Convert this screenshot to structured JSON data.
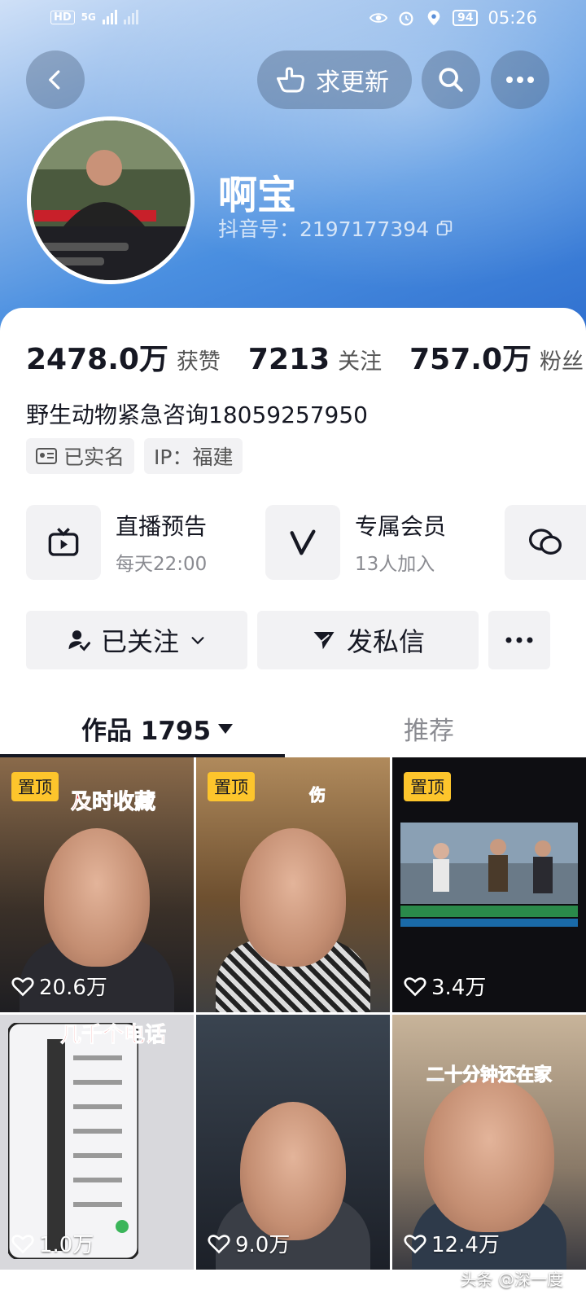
{
  "status_bar": {
    "hd": "HD",
    "net": "5G",
    "battery": "94",
    "time": "05:26"
  },
  "header": {
    "request_update_label": "求更新",
    "name": "啊宝",
    "douyin_id": "抖音号：2197177394"
  },
  "stats": [
    {
      "value": "2478.0万",
      "label": "获赞"
    },
    {
      "value": "7213",
      "label": "关注"
    },
    {
      "value": "757.0万",
      "label": "粉丝"
    }
  ],
  "bio": "野生动物紧急咨询18059257950",
  "tags": {
    "verified": "已实名",
    "ip": "IP：福建"
  },
  "features": [
    {
      "title": "直播预告",
      "subtitle": "每天22:00",
      "icon": "tv-icon"
    },
    {
      "title": "专属会员",
      "subtitle": "13人加入",
      "icon": "v-icon"
    }
  ],
  "actions": {
    "followed_label": "已关注",
    "message_label": "发私信"
  },
  "tabs": {
    "works_label": "作品 1795",
    "recommend_label": "推荐"
  },
  "videos": [
    {
      "pinned": "置顶",
      "caption": "及时收藏",
      "likes": "20.6万"
    },
    {
      "pinned": "置顶",
      "caption": "伤",
      "likes": ""
    },
    {
      "pinned": "置顶",
      "caption": "",
      "likes": "3.4万"
    },
    {
      "pinned": "",
      "caption": "几千个电话",
      "likes": "1.0万"
    },
    {
      "pinned": "",
      "caption": "",
      "likes": "9.0万"
    },
    {
      "pinned": "",
      "caption": "二十分钟还在家",
      "likes": "12.4万"
    }
  ],
  "watermark": "头条 @深一度",
  "colors": {
    "pin_yellow": "#fdc52c",
    "caption_red": "#e02020",
    "header_blue": "#4a8fe0"
  }
}
